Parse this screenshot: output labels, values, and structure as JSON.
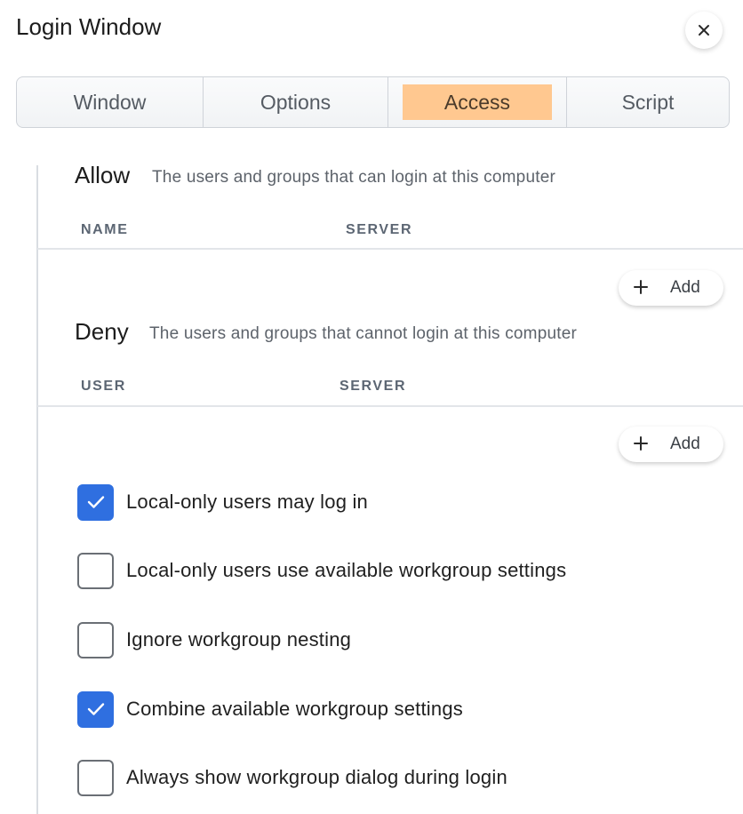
{
  "window": {
    "title": "Login Window"
  },
  "tabs": [
    {
      "label": "Window",
      "active": false
    },
    {
      "label": "Options",
      "active": false
    },
    {
      "label": "Access",
      "active": true
    },
    {
      "label": "Script",
      "active": false
    }
  ],
  "allow": {
    "title": "Allow",
    "description": "The users and groups that can login at this computer",
    "columns": [
      "NAME",
      "SERVER"
    ],
    "rows": [],
    "add_label": "Add"
  },
  "deny": {
    "title": "Deny",
    "description": "The users and groups that cannot login at this computer",
    "columns": [
      "USER",
      "SERVER"
    ],
    "rows": [],
    "add_label": "Add"
  },
  "options": [
    {
      "label": "Local-only users may log in",
      "checked": true
    },
    {
      "label": "Local-only users use available workgroup settings",
      "checked": false
    },
    {
      "label": "Ignore workgroup nesting",
      "checked": false
    },
    {
      "label": "Combine available workgroup settings",
      "checked": true
    },
    {
      "label": "Always show workgroup dialog during login",
      "checked": false
    }
  ],
  "colors": {
    "accent": "#2f6fe0",
    "active_tab": "#ffc890"
  },
  "icons": {
    "close": "close-icon",
    "add": "plus-icon",
    "check": "checkmark-icon"
  }
}
